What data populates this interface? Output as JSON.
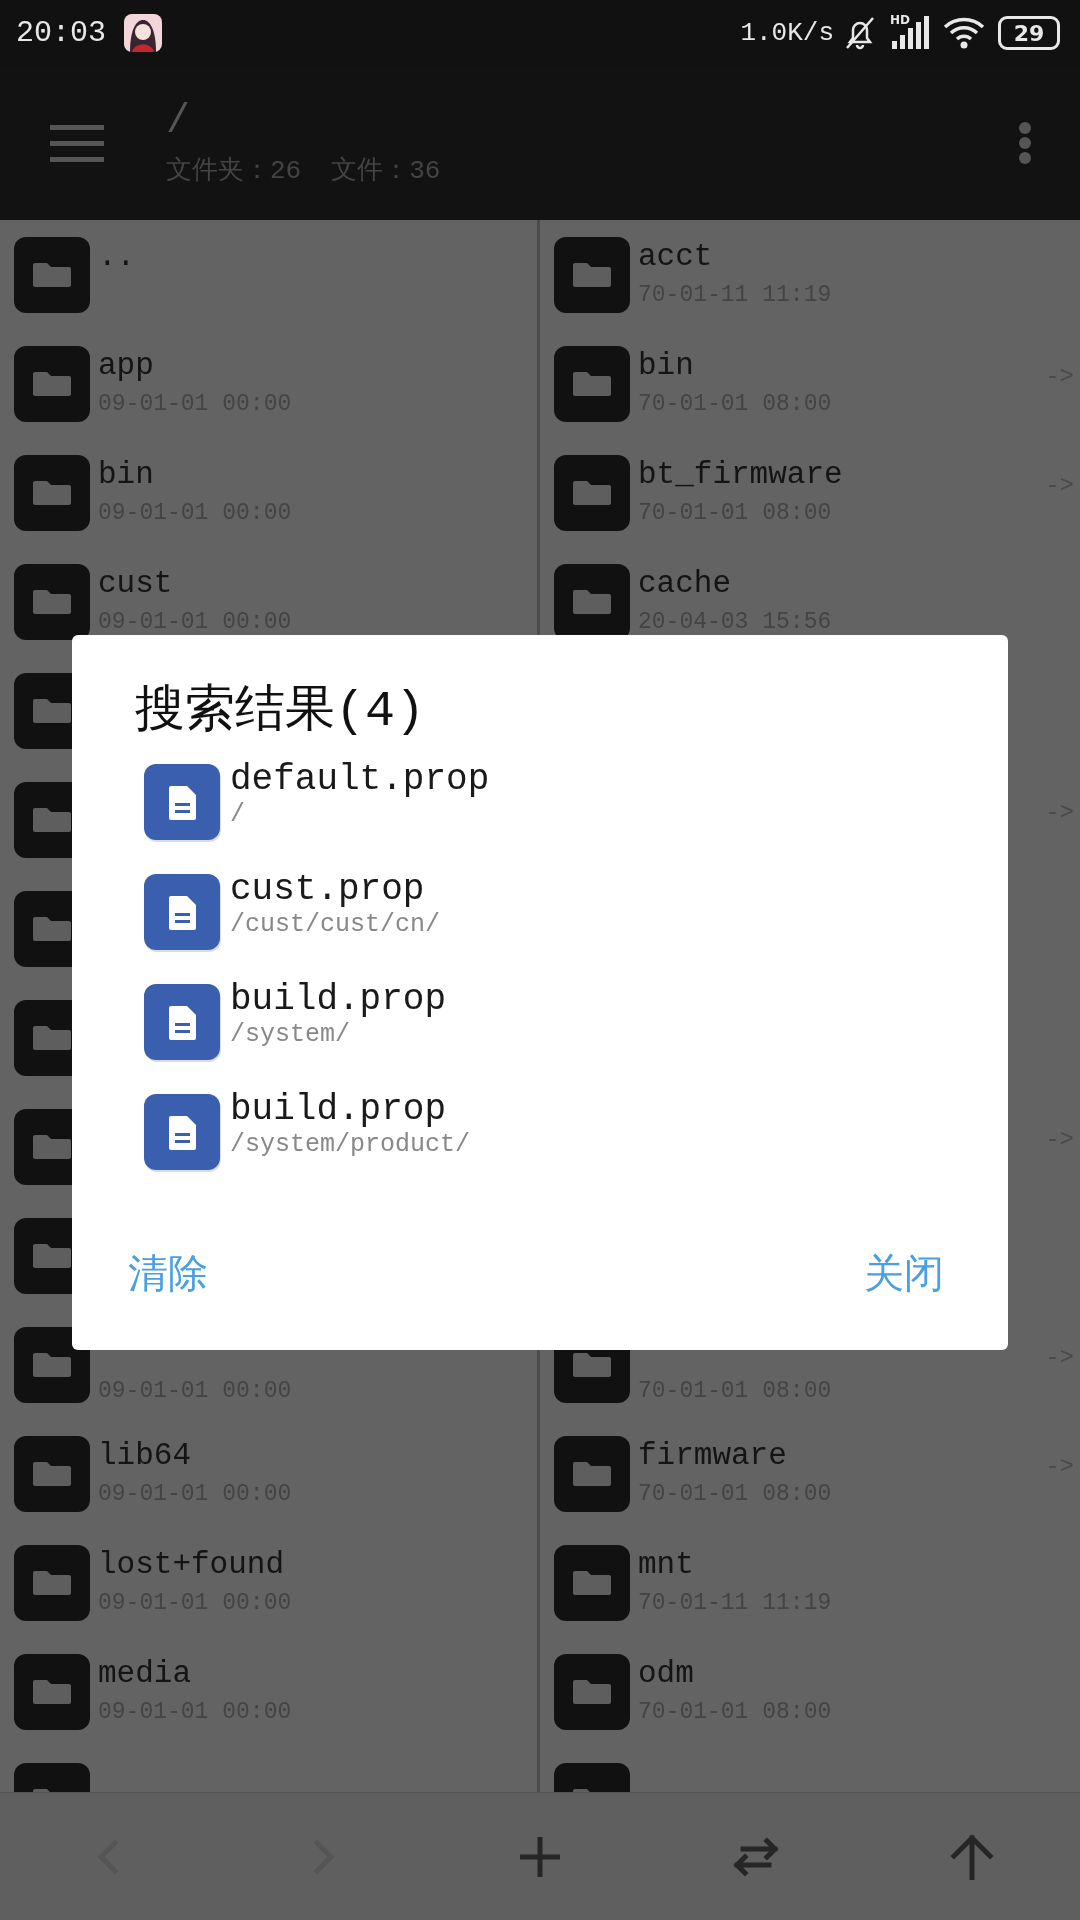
{
  "status_bar": {
    "time": "20:03",
    "net_speed": "1.0K/s",
    "network_type": "HD",
    "battery": "29"
  },
  "toolbar": {
    "path": "/",
    "folder_count": "文件夹：26",
    "file_count": "文件：36"
  },
  "columns": [
    {
      "rows": [
        {
          "name": ".."
        },
        {
          "name": "app",
          "date": "09-01-01 00:00"
        },
        {
          "name": "bin",
          "date": "09-01-01 00:00"
        },
        {
          "name": "cust",
          "date": "09-01-01 00:00"
        },
        {},
        {},
        {},
        {},
        {},
        {},
        {
          "date": "09-01-01 00:00"
        },
        {
          "name": "lib64",
          "date": "09-01-01 00:00"
        },
        {
          "name": "lost+found",
          "date": "09-01-01 00:00"
        },
        {
          "name": "media",
          "date": "09-01-01 00:00"
        },
        {}
      ]
    },
    {
      "rows": [
        {
          "name": "acct",
          "date": "70-01-11 11:19"
        },
        {
          "name": "bin",
          "date": "70-01-01 08:00",
          "arrow": "->"
        },
        {
          "name": "bt_firmware",
          "date": "70-01-01 08:00",
          "arrow": "->"
        },
        {
          "name": "cache",
          "date": "20-04-03 15:56"
        },
        {},
        {
          "arrow": "->"
        },
        {},
        {},
        {
          "arrow": "->"
        },
        {},
        {
          "date": "70-01-01 08:00",
          "arrow": "->"
        },
        {
          "name": "firmware",
          "date": "70-01-01 08:00",
          "arrow": "->"
        },
        {
          "name": "mnt",
          "date": "70-01-11 11:19"
        },
        {
          "name": "odm",
          "date": "70-01-01 08:00"
        },
        {}
      ]
    }
  ],
  "dialog": {
    "title": "搜索结果(4)",
    "results": [
      {
        "name": "default.prop",
        "path": "/"
      },
      {
        "name": "cust.prop",
        "path": "/cust/cust/cn/"
      },
      {
        "name": "build.prop",
        "path": "/system/"
      },
      {
        "name": "build.prop",
        "path": "/system/product/"
      }
    ],
    "buttons": [
      {
        "label": "清除"
      },
      {
        "label": "关闭"
      }
    ]
  },
  "bottom_bar": [
    {
      "kind": "back",
      "disabled": true
    },
    {
      "kind": "forward",
      "disabled": true
    },
    {
      "kind": "add",
      "disabled": false
    },
    {
      "kind": "swap",
      "disabled": false
    },
    {
      "kind": "up",
      "disabled": false
    }
  ]
}
